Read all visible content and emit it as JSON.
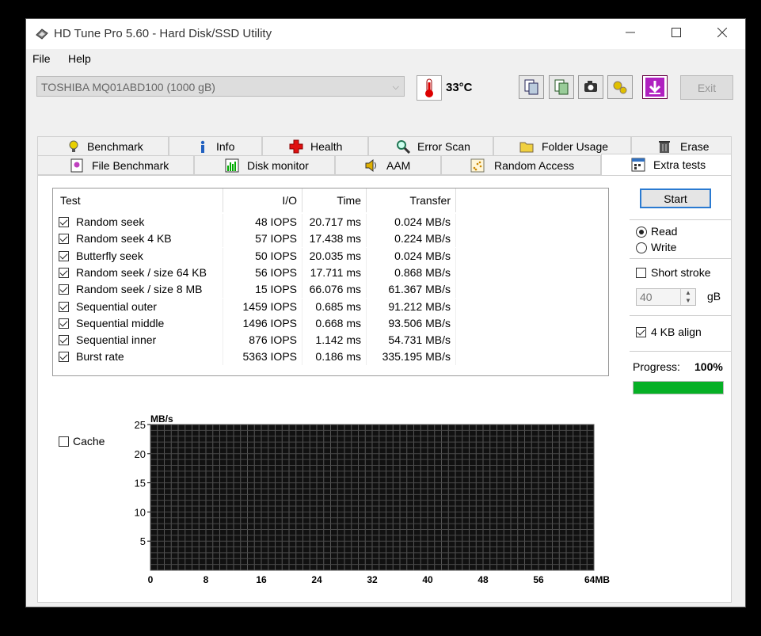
{
  "window": {
    "title": "HD Tune Pro 5.60 - Hard Disk/SSD Utility"
  },
  "menu": [
    {
      "label": "File"
    },
    {
      "label": "Help"
    }
  ],
  "toolbar": {
    "drive": "TOSHIBA MQ01ABD100 (1000 gB)",
    "temperature": "33°C",
    "exit_label": "Exit"
  },
  "tabs_row1": [
    {
      "label": "Benchmark",
      "icon": "bulb-icon"
    },
    {
      "label": "Info",
      "icon": "info-icon"
    },
    {
      "label": "Health",
      "icon": "health-cross-icon"
    },
    {
      "label": "Error Scan",
      "icon": "magnifier-icon"
    },
    {
      "label": "Folder Usage",
      "icon": "folder-icon"
    },
    {
      "label": "Erase",
      "icon": "trash-icon"
    }
  ],
  "tabs_row2": [
    {
      "label": "File Benchmark",
      "icon": "file-benchmark-icon"
    },
    {
      "label": "Disk monitor",
      "icon": "disk-monitor-icon"
    },
    {
      "label": "AAM",
      "icon": "speaker-icon"
    },
    {
      "label": "Random Access",
      "icon": "scatter-icon"
    },
    {
      "label": "Extra tests",
      "icon": "extra-tests-icon"
    }
  ],
  "results": {
    "headers": {
      "test": "Test",
      "io": "I/O",
      "time": "Time",
      "transfer": "Transfer"
    },
    "rows": [
      {
        "test": "Random seek",
        "io": "48 IOPS",
        "time": "20.717 ms",
        "transfer": "0.024 MB/s",
        "checked": true
      },
      {
        "test": "Random seek 4 KB",
        "io": "57 IOPS",
        "time": "17.438 ms",
        "transfer": "0.224 MB/s",
        "checked": true
      },
      {
        "test": "Butterfly seek",
        "io": "50 IOPS",
        "time": "20.035 ms",
        "transfer": "0.024 MB/s",
        "checked": true
      },
      {
        "test": "Random seek / size 64 KB",
        "io": "56 IOPS",
        "time": "17.711 ms",
        "transfer": "0.868 MB/s",
        "checked": true
      },
      {
        "test": "Random seek / size 8 MB",
        "io": "15 IOPS",
        "time": "66.076 ms",
        "transfer": "61.367 MB/s",
        "checked": true
      },
      {
        "test": "Sequential outer",
        "io": "1459 IOPS",
        "time": "0.685 ms",
        "transfer": "91.212 MB/s",
        "checked": true
      },
      {
        "test": "Sequential middle",
        "io": "1496 IOPS",
        "time": "0.668 ms",
        "transfer": "93.506 MB/s",
        "checked": true
      },
      {
        "test": "Sequential inner",
        "io": "876 IOPS",
        "time": "1.142 ms",
        "transfer": "54.731 MB/s",
        "checked": true
      },
      {
        "test": "Burst rate",
        "io": "5363 IOPS",
        "time": "0.186 ms",
        "transfer": "335.195 MB/s",
        "checked": true
      }
    ]
  },
  "cache": {
    "label": "Cache",
    "checked": false
  },
  "controls": {
    "start_label": "Start",
    "read_label": "Read",
    "write_label": "Write",
    "mode": "read",
    "short_stroke_label": "Short stroke",
    "short_stroke_checked": false,
    "short_stroke_value": "40",
    "short_stroke_unit": "gB",
    "align_label": "4 KB align",
    "align_checked": true,
    "progress_label": "Progress:",
    "progress_text": "100%",
    "progress": 100
  },
  "chart_data": {
    "type": "line",
    "ylabel": "MB/s",
    "ylim": [
      0,
      25
    ],
    "yticks": [
      "25",
      "20",
      "15",
      "10",
      "5"
    ],
    "xlim": [
      0,
      64
    ],
    "xticks": [
      "0",
      "8",
      "16",
      "24",
      "32",
      "40",
      "48",
      "56",
      "64MB"
    ],
    "grid": true,
    "series": []
  }
}
